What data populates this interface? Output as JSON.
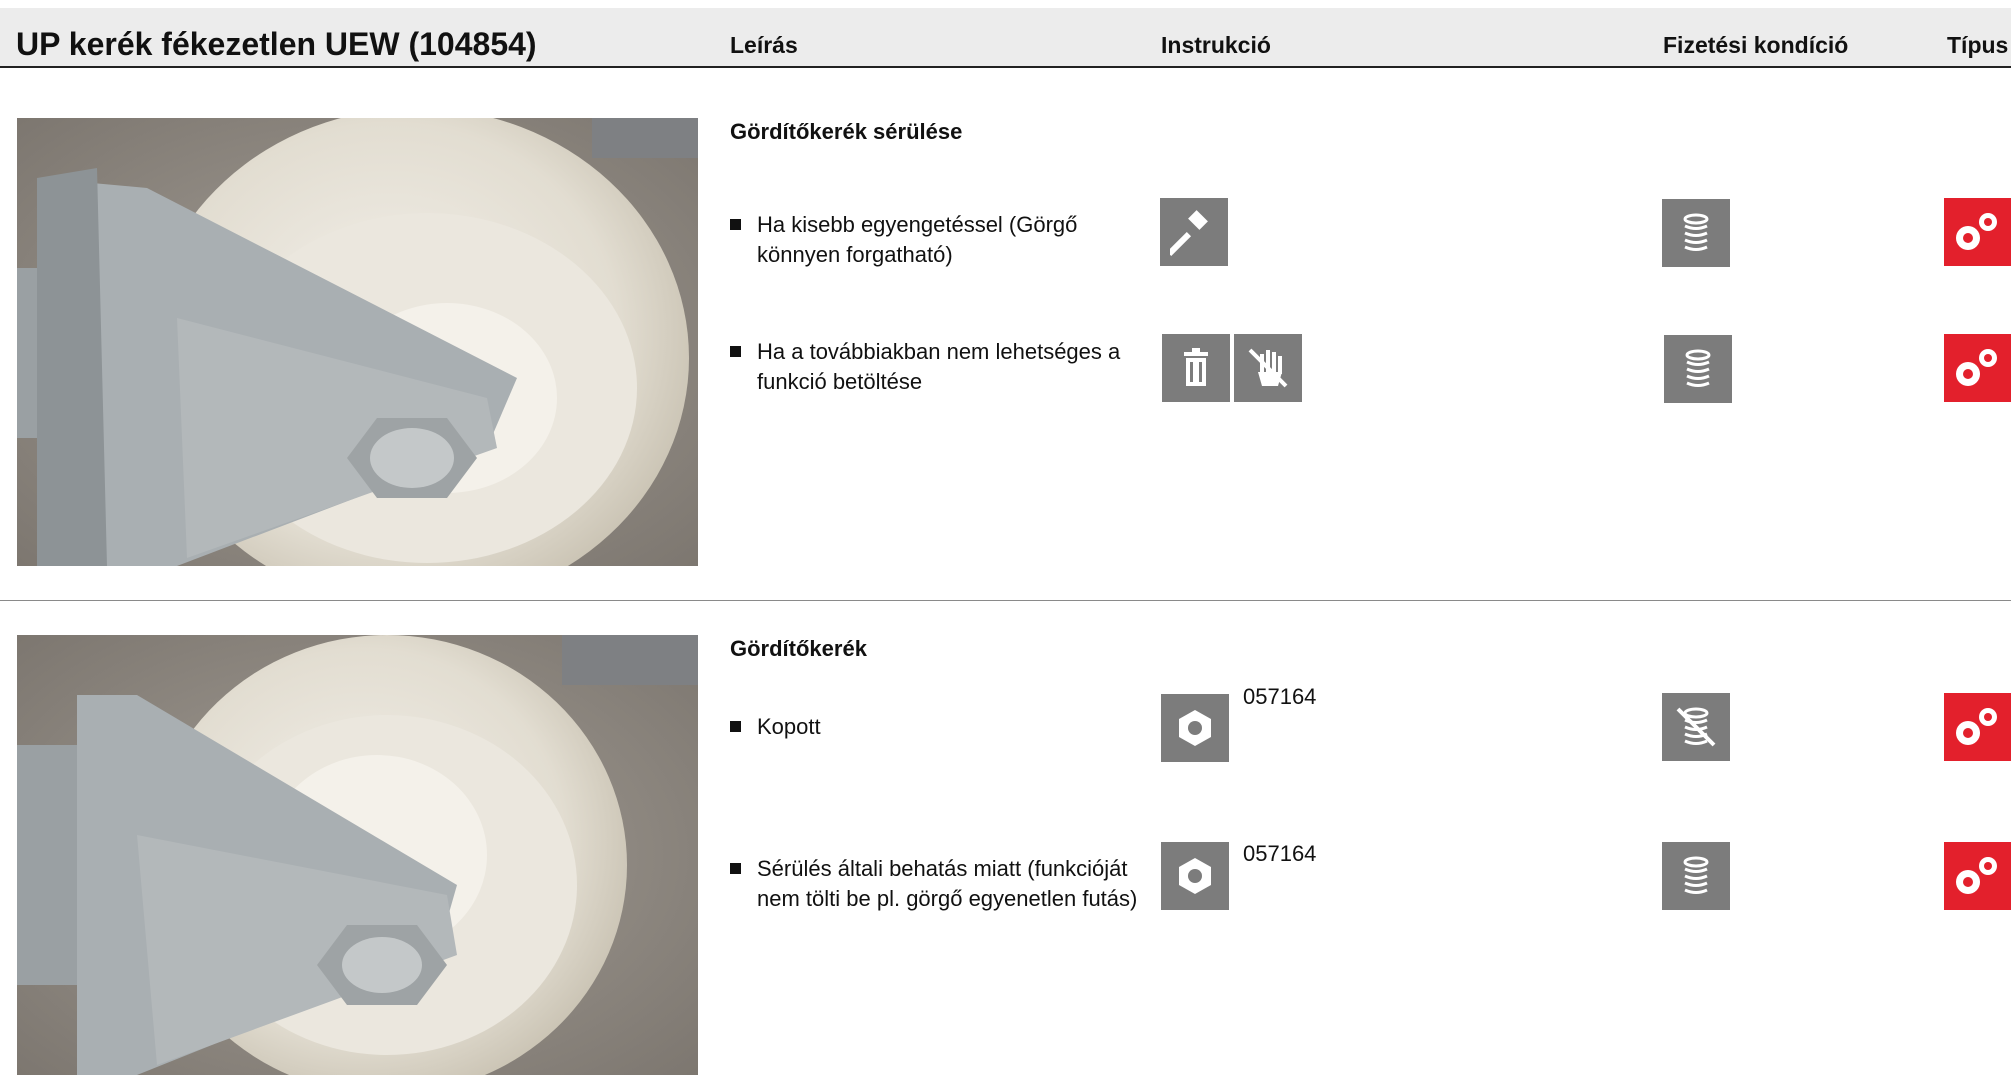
{
  "header": {
    "title": "UP kerék fékezetlen UEW (104854)",
    "columns": {
      "description": "Leírás",
      "instruction": "Instrukció",
      "payment": "Fizetési kondíció",
      "type": "Típus"
    }
  },
  "sections": [
    {
      "heading": "Gördítőkerék sérülése",
      "photo_icon": "caster-wheel-photo",
      "items": [
        {
          "text": "Ha kisebb egyengetéssel (Görgő könnyen forgatható)",
          "instruction_icons": [
            "hammer-icon"
          ],
          "payment_icon": "coin-stack-icon",
          "type_icon": "gears-icon"
        },
        {
          "text": "Ha a továbbiakban nem lehetséges a funkció betöltése",
          "instruction_icons": [
            "trash-icon",
            "no-repair-hand-icon"
          ],
          "payment_icon": "coin-stack-icon",
          "type_icon": "gears-icon"
        }
      ]
    },
    {
      "heading": "Gördítőkerék",
      "photo_icon": "caster-wheel-photo",
      "items": [
        {
          "text": "Kopott",
          "instruction_icons": [
            "hex-nut-icon"
          ],
          "part_number": "057164",
          "payment_icon": "coin-stack-crossed-icon",
          "type_icon": "gears-icon"
        },
        {
          "text": "Sérülés általi behatás miatt (funkcióját nem tölti be pl. görgő egyenetlen futás)",
          "instruction_icons": [
            "hex-nut-icon"
          ],
          "part_number": "057164",
          "payment_icon": "coin-stack-icon",
          "type_icon": "gears-icon"
        }
      ]
    }
  ],
  "colors": {
    "icon_tile": "#7c7c7c",
    "type_tile": "#e3202c",
    "header_bg": "#ececec"
  }
}
